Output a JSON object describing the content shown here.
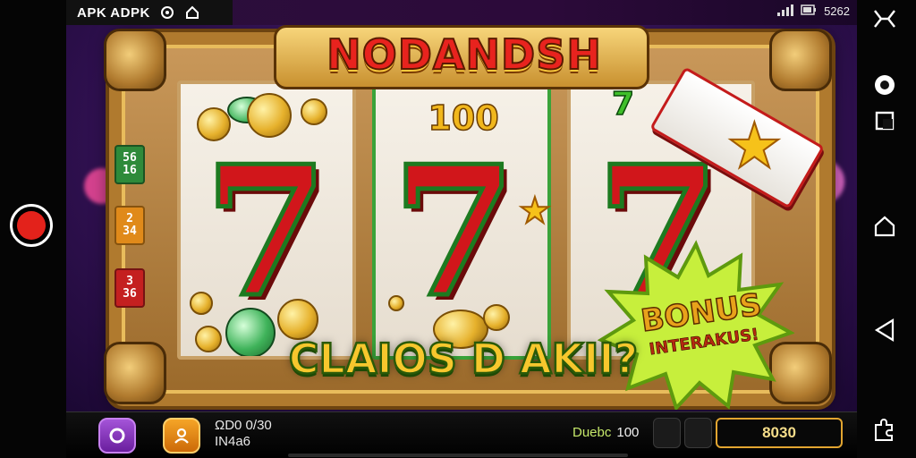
{
  "status_bar": {
    "app_label": "APK ADPK",
    "right_text": "5262",
    "icons": [
      "settings-cycle-icon",
      "home-icon",
      "signal-icon",
      "battery-icon"
    ]
  },
  "game": {
    "title": "NODANDSH",
    "reel_value": "100",
    "reel_symbols": [
      "7",
      "7",
      "7"
    ],
    "side_badges": [
      {
        "label": "56\n16",
        "color": "#2e8a3a"
      },
      {
        "label": "2\n34",
        "color": "#e08a1a"
      },
      {
        "label": "3\n36",
        "color": "#c42020"
      }
    ],
    "bonus_title": "BONUS",
    "bonus_sub": "INTERAKUS!",
    "banner": "CLAIOS D AKII?",
    "top_reel_text": "7"
  },
  "bottom_bar": {
    "info_line1": "ΩD0 0/30",
    "info_line2": "IN4a6",
    "bet_label": "Duebc",
    "bet_value": "100",
    "credit_value": "8030"
  },
  "nav": {
    "icons": [
      "screenshot-icon",
      "camera-icon",
      "square-icon",
      "home-icon",
      "back-icon",
      "puzzle-icon"
    ]
  },
  "colors": {
    "frame_gold": "#b07a2e",
    "scene_purple": "#3b1560",
    "seven_red": "#d1161b",
    "credit_border": "#e2a530"
  }
}
